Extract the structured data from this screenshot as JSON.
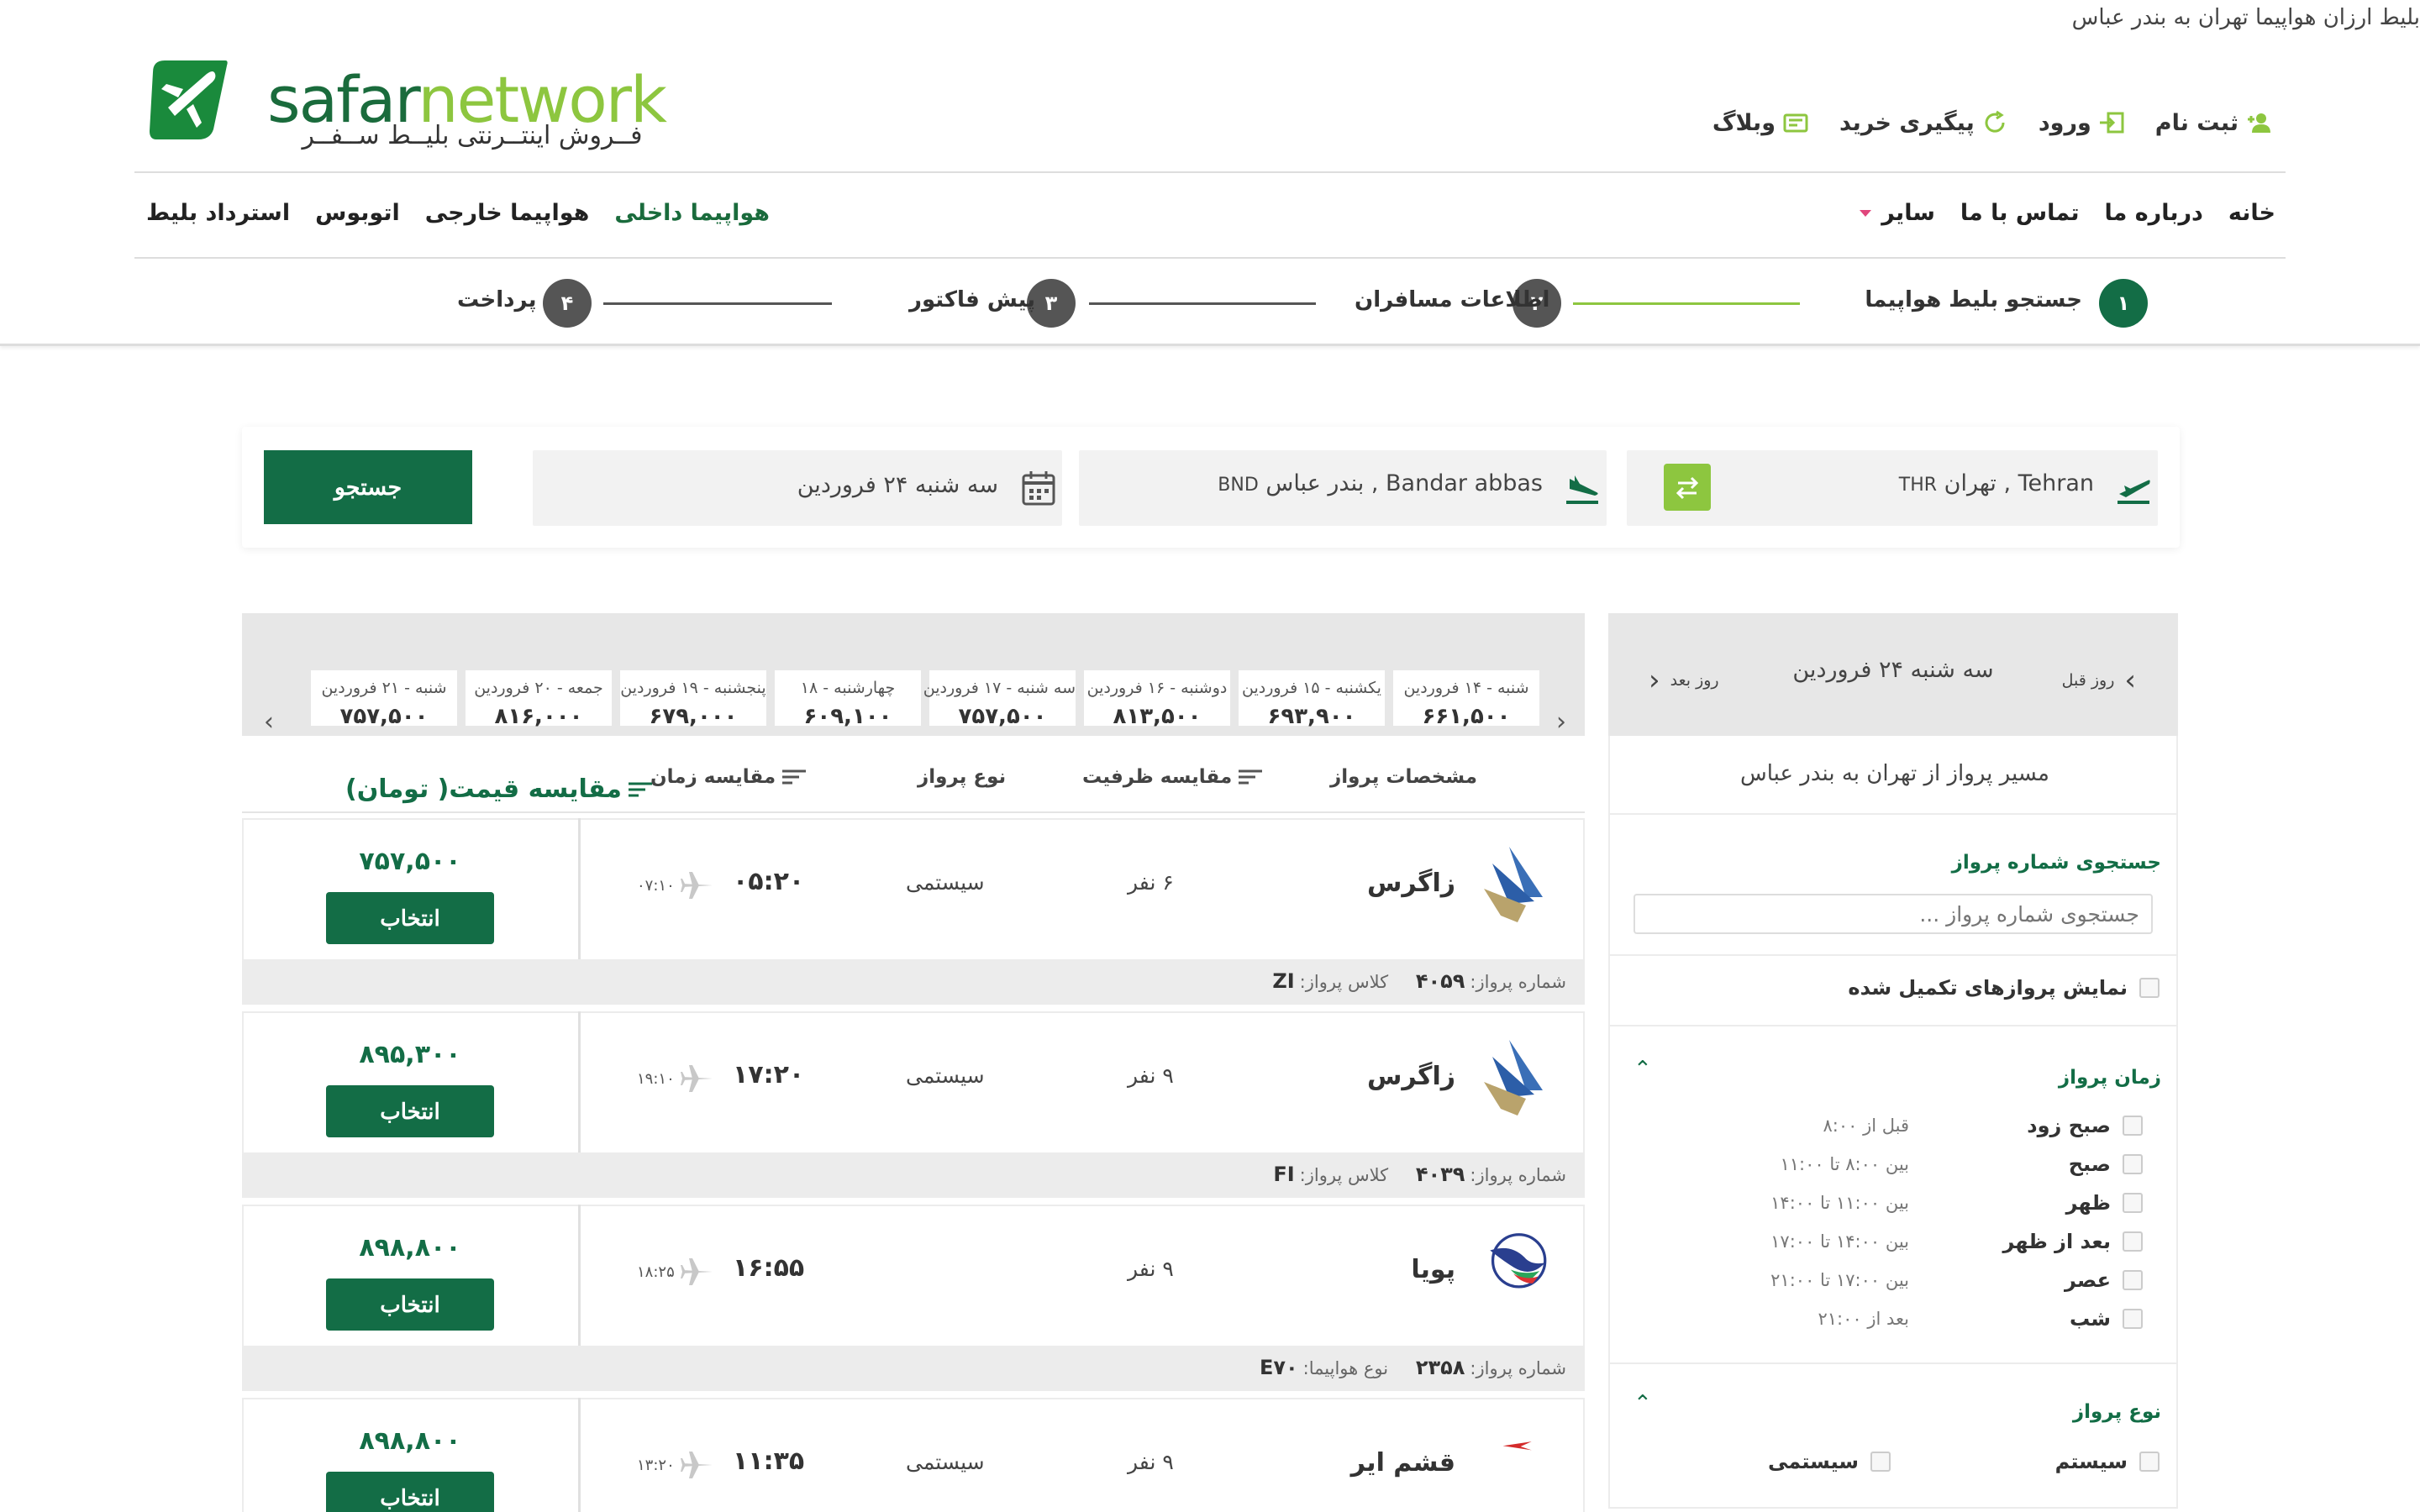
{
  "page_top_title": "بلیط ارزان هواپیما تهران به بندر عباس",
  "logo": {
    "word_a": "safar",
    "word_b": "network",
    "tagline": "فــروش اینتــرنتی بلیــط ســفــر"
  },
  "header": {
    "links": [
      {
        "label": "ثبت نام",
        "icon": "user-add-icon"
      },
      {
        "label": "ورود",
        "icon": "login-icon"
      },
      {
        "label": "پیگیری خرید",
        "icon": "refresh-icon"
      },
      {
        "label": "وبلاگ",
        "icon": "blog-icon"
      }
    ]
  },
  "nav": {
    "right": {
      "home": "خانه",
      "about": "درباره ما",
      "contact": "تماس با ما",
      "other": "سایر"
    },
    "left": {
      "domestic": "هواپیما داخلی",
      "international": "هواپیما خارجی",
      "bus": "اتوبوس",
      "refund": "استرداد بلیط"
    }
  },
  "steps": [
    {
      "num": "۱",
      "label": "جستجو بلیط هواپیما",
      "active": true
    },
    {
      "num": "۲",
      "label": "اطلاعات مسافران",
      "active": false
    },
    {
      "num": "۳",
      "label": "پیش فاکتور",
      "active": false
    },
    {
      "num": "۴",
      "label": "پرداخت",
      "active": false
    }
  ],
  "search": {
    "origin": "Tehran , تهران",
    "origin_code": "THR",
    "destination": "Bandar abbas , بندر عباس",
    "destination_code": "BND",
    "date": "سه شنبه ۲۴ فروردین",
    "button": "جستجو"
  },
  "dates": [
    {
      "day": "شنبه - ۱۴ فروردین",
      "price": "۶۶۱,۵۰۰"
    },
    {
      "day": "یکشنبه - ۱۵ فروردین",
      "price": "۶۹۳,۹۰۰"
    },
    {
      "day": "دوشنبه - ۱۶ فروردین",
      "price": "۸۱۳,۵۰۰"
    },
    {
      "day": "سه شنبه - ۱۷ فروردین",
      "price": "۷۵۷,۵۰۰"
    },
    {
      "day": "چهارشنبه - ۱۸",
      "price": "۶۰۹,۱۰۰"
    },
    {
      "day": "پنجشنبه - ۱۹ فروردین",
      "price": "۶۷۹,۰۰۰"
    },
    {
      "day": "جمعه - ۲۰ فروردین",
      "price": "۸۱۶,۰۰۰"
    },
    {
      "day": "شنبه - ۲۱ فروردین",
      "price": "۷۵۷,۵۰۰"
    }
  ],
  "table_headers": {
    "specs": "مشخصات پرواز",
    "capacity": "مقایسه ظرفیت",
    "type": "نوع پرواز",
    "time": "مقایسه زمان",
    "price": "مقایسه قیمت( تومان)"
  },
  "flights": [
    {
      "airline": "زاگرس",
      "logo": "zagros",
      "capacity": "۶ نفر",
      "type": "سیستمی",
      "dep": "۰۵:۲۰",
      "arr": "۰۷:۱۰",
      "price": "۷۵۷,۵۰۰",
      "button": "انتخاب",
      "foot_label1": "شماره پرواز:",
      "foot_value1": "۴۰۵۹",
      "foot_label2": "کلاس پرواز:",
      "foot_value2": "ZI"
    },
    {
      "airline": "زاگرس",
      "logo": "zagros",
      "capacity": "۹ نفر",
      "type": "سیستمی",
      "dep": "۱۷:۲۰",
      "arr": "۱۹:۱۰",
      "price": "۸۹۵,۳۰۰",
      "button": "انتخاب",
      "foot_label1": "شماره پرواز:",
      "foot_value1": "۴۰۳۹",
      "foot_label2": "کلاس پرواز:",
      "foot_value2": "FI"
    },
    {
      "airline": "پویا",
      "logo": "pouya",
      "capacity": "۹ نفر",
      "type": "",
      "dep": "۱۶:۵۵",
      "arr": "۱۸:۲۵",
      "price": "۸۹۸,۸۰۰",
      "button": "انتخاب",
      "foot_label1": "شماره پرواز:",
      "foot_value1": "۲۳۵۸",
      "foot_label2": "نوع هواپیما:",
      "foot_value2": "E۷۰"
    },
    {
      "airline": "قشم ایر",
      "logo": "qeshm",
      "capacity": "۹ نفر",
      "type": "سیستمی",
      "dep": "۱۱:۳۵",
      "arr": "۱۳:۲۰",
      "price": "۸۹۸,۸۰۰",
      "button": "انتخاب",
      "foot_label1": "",
      "foot_value1": "",
      "foot_label2": "",
      "foot_value2": ""
    }
  ],
  "sidebar": {
    "prev_day": "روز قبل",
    "next_day": "روز بعد",
    "current_date": "سه شنبه ۲۴ فروردین",
    "route": "مسیر پرواز از تهران به بندر عباس",
    "flight_search_title": "جستجوی شماره پرواز",
    "flight_search_placeholder": "جستجوی شماره پرواز ...",
    "show_full": "نمایش پروازهای تکمیل شده",
    "time_title": "زمان پرواز",
    "times": [
      {
        "label": "صبح زود",
        "range": "قبل از ۸:۰۰"
      },
      {
        "label": "صبح",
        "range": "بین ۸:۰۰ تا ۱۱:۰۰"
      },
      {
        "label": "ظهر",
        "range": "بین ۱۱:۰۰ تا ۱۴:۰۰"
      },
      {
        "label": "بعد از ظهر",
        "range": "بین ۱۴:۰۰ تا ۱۷:۰۰"
      },
      {
        "label": "عصر",
        "range": "بین ۱۷:۰۰ تا ۲۱:۰۰"
      },
      {
        "label": "شب",
        "range": "بعد از ۲۱:۰۰"
      }
    ],
    "type_title": "نوع پرواز",
    "types": [
      "سیستم",
      "سیستمی"
    ]
  },
  "colors": {
    "brand_green": "#136d46",
    "light_green": "#8dc63f",
    "step_gray": "#555555"
  }
}
